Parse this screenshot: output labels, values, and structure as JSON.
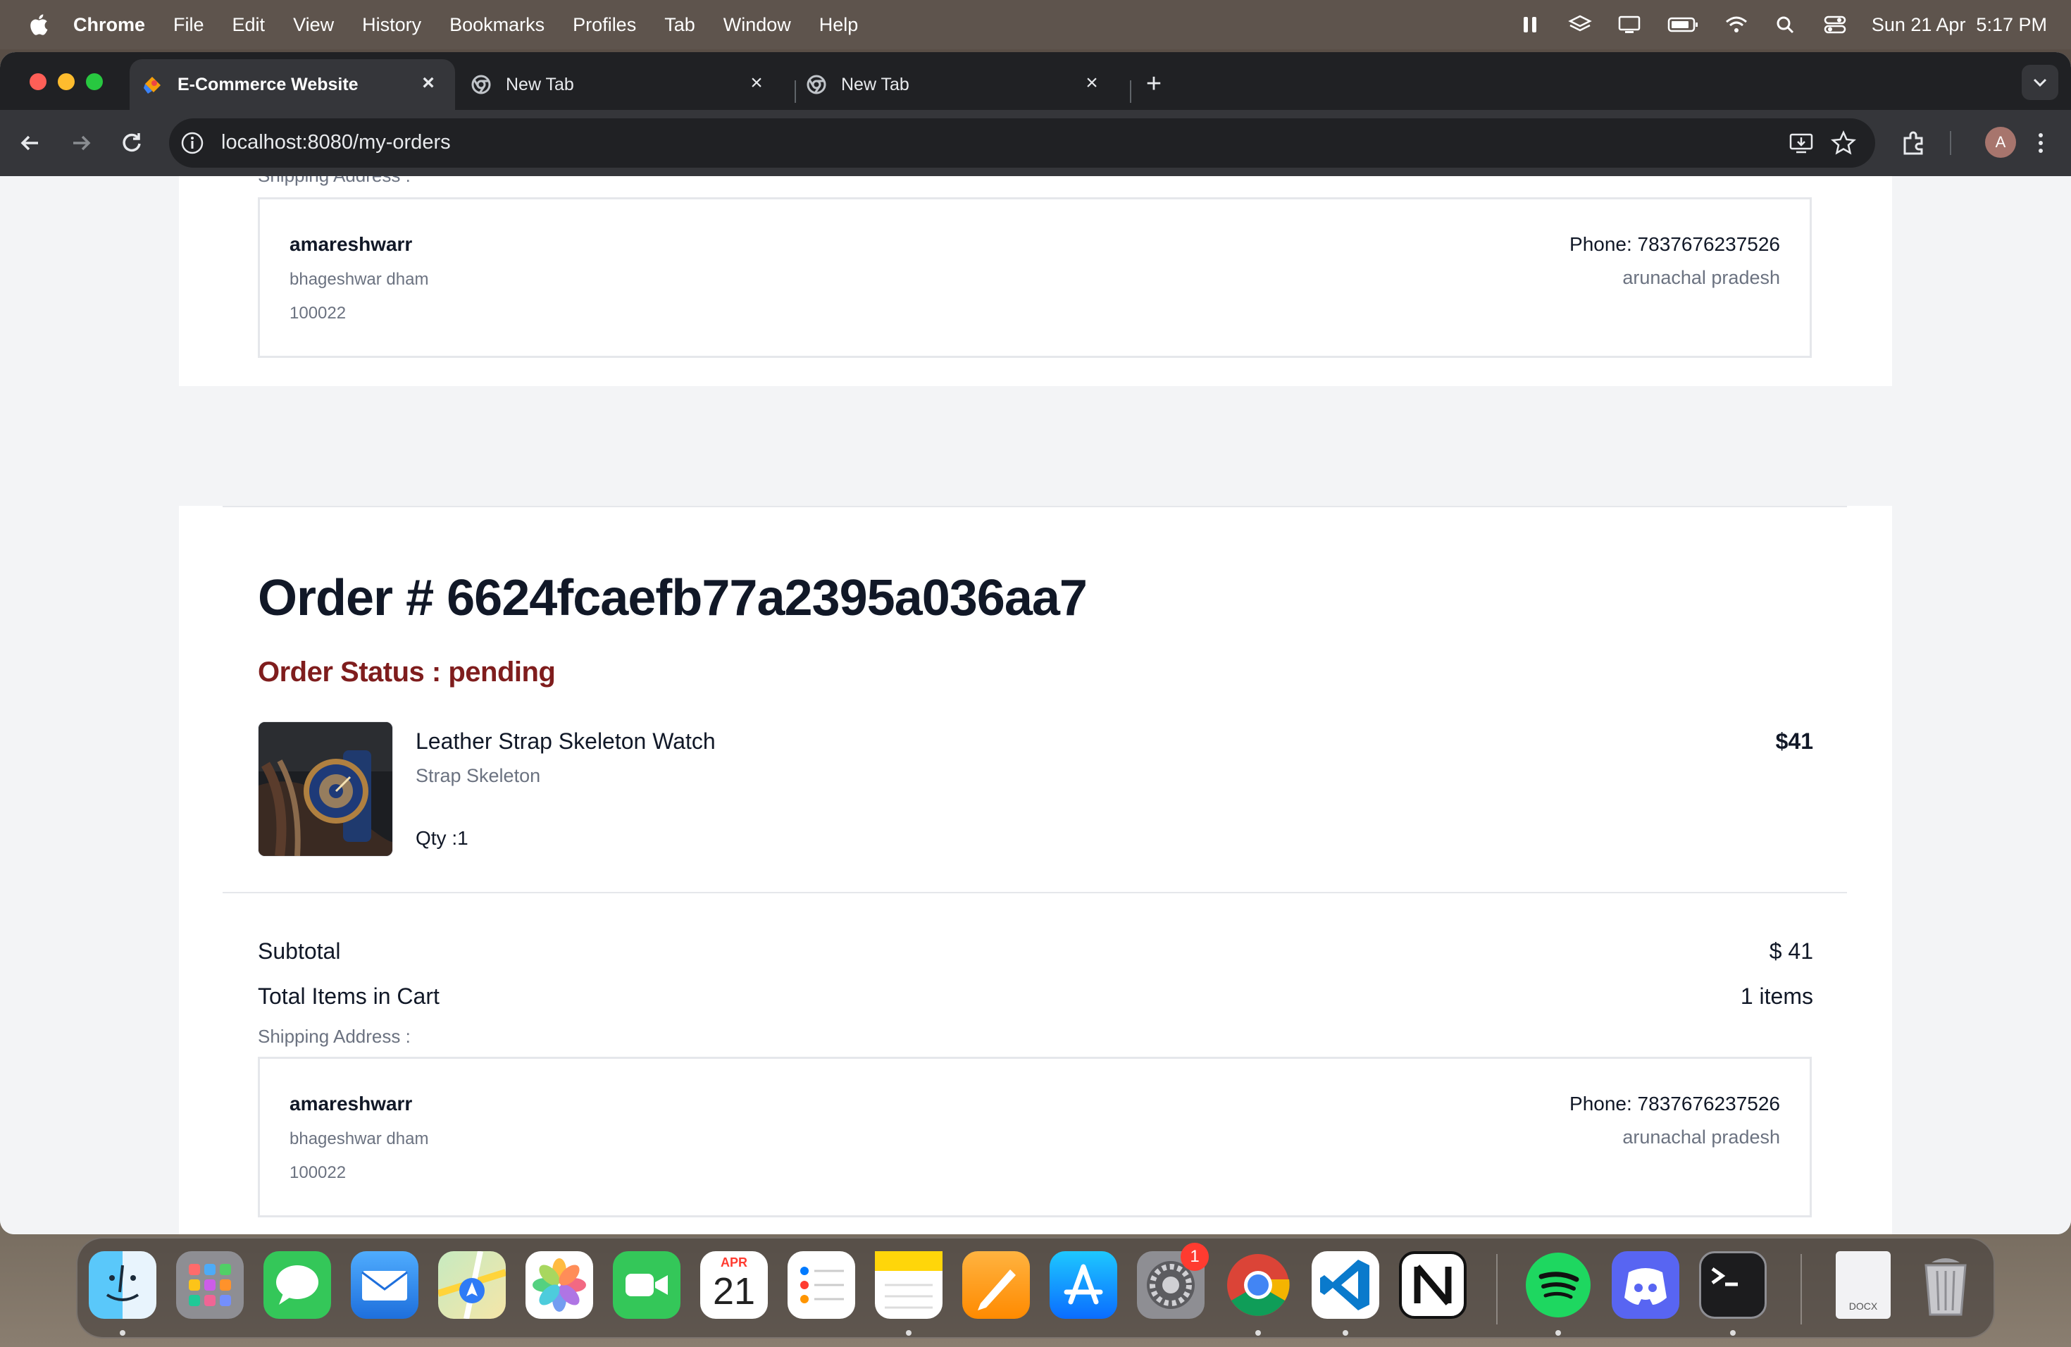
{
  "menubar": {
    "app_name": "Chrome",
    "items": [
      "File",
      "Edit",
      "View",
      "History",
      "Bookmarks",
      "Profiles",
      "Tab",
      "Window",
      "Help"
    ],
    "datetime": "Sun 21 Apr  5:17 PM"
  },
  "browser": {
    "tabs": [
      {
        "title": "E-Commerce Website",
        "active": true
      },
      {
        "title": "New Tab",
        "active": false
      },
      {
        "title": "New Tab",
        "active": false
      }
    ],
    "url": "localhost:8080/my-orders",
    "profile_initial": "A"
  },
  "prev_order": {
    "shipping_label": "Shipping Address :",
    "address": {
      "name": "amareshwarr",
      "street": "bhageshwar dham",
      "pincode": "100022",
      "phone": "Phone: 7837676237526",
      "state": "arunachal pradesh"
    }
  },
  "order": {
    "title": "Order # 6624fcaefb77a2395a036aa7",
    "status": "Order Status : pending",
    "items": [
      {
        "name": "Leather Strap Skeleton Watch",
        "brand": "Strap Skeleton",
        "qty": "Qty :1",
        "price": "$41"
      }
    ],
    "subtotal_label": "Subtotal",
    "subtotal_value": "$ 41",
    "total_items_label": "Total Items in Cart",
    "total_items_value": "1 items",
    "shipping_label": "Shipping Address :",
    "address": {
      "name": "amareshwarr",
      "street": "bhageshwar dham",
      "pincode": "100022",
      "phone": "Phone: 7837676237526",
      "state": "arunachal pradesh"
    }
  },
  "dock": {
    "calendar_month": "APR",
    "calendar_day": "21",
    "settings_badge": "1",
    "doc_label": "DOCX",
    "apps": [
      "finder-icon",
      "launchpad-icon",
      "messages-icon",
      "mail-icon",
      "maps-icon",
      "photos-icon",
      "facetime-icon",
      "calendar-icon",
      "reminders-icon",
      "notes-icon",
      "pages-icon",
      "app-store-icon",
      "system-settings-icon",
      "chrome-icon",
      "vscode-icon",
      "notion-icon",
      "spotify-icon",
      "discord-icon",
      "terminal-icon",
      "document-icon",
      "trash-icon"
    ]
  }
}
